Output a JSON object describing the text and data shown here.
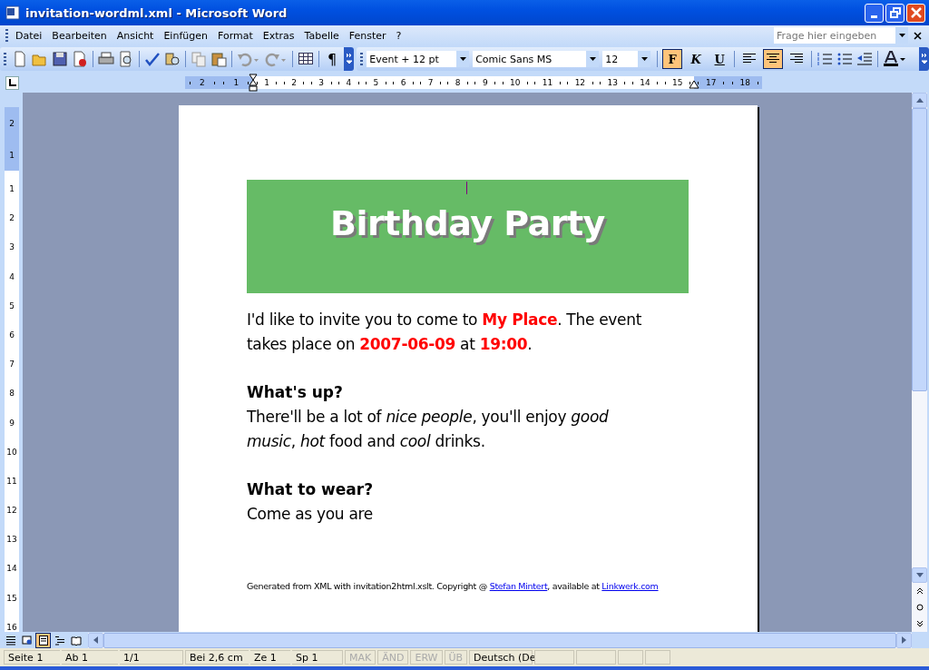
{
  "window": {
    "title": "invitation-wordml.xml - Microsoft Word"
  },
  "menu": [
    {
      "label": "Datei"
    },
    {
      "label": "Bearbeiten"
    },
    {
      "label": "Ansicht"
    },
    {
      "label": "Einfügen"
    },
    {
      "label": "Format"
    },
    {
      "label": "Extras"
    },
    {
      "label": "Tabelle"
    },
    {
      "label": "Fenster"
    },
    {
      "label": "?"
    }
  ],
  "help_box": {
    "placeholder": "Frage hier eingeben"
  },
  "toolbar": {
    "pilcrow": "¶",
    "style": "Event + 12 pt",
    "font": "Comic Sans MS",
    "size": "12",
    "format_buttons": [
      {
        "kind": "bold",
        "label": "F",
        "selected": true
      },
      {
        "kind": "italic",
        "label": "K",
        "selected": false
      },
      {
        "kind": "underline",
        "label": "U",
        "selected": false
      }
    ],
    "align_buttons": [
      {
        "kind": "left",
        "selected": false
      },
      {
        "kind": "center",
        "selected": true
      },
      {
        "kind": "right",
        "selected": false
      }
    ]
  },
  "ruler": {
    "left_labels": [
      "2",
      "1"
    ],
    "labels": [
      "1",
      "2",
      "3",
      "4",
      "5",
      "6",
      "7",
      "8",
      "9",
      "10",
      "11",
      "12",
      "13",
      "14",
      "15"
    ],
    "right_labels": [
      "17",
      "18"
    ]
  },
  "vertical_ruler": {
    "top_labels": [
      "2",
      "1"
    ],
    "labels": [
      "1",
      "2",
      "3",
      "4",
      "5",
      "6",
      "7",
      "8",
      "9",
      "10",
      "11",
      "12",
      "13",
      "14",
      "15",
      "16"
    ]
  },
  "document": {
    "banner": "Birthday Party",
    "blocks": [
      {
        "kind": "para",
        "segments": [
          {
            "kind": "plain",
            "text": "I'd like to invite you to come to "
          },
          {
            "kind": "highlight",
            "text": "My Place"
          },
          {
            "kind": "plain",
            "text": ". The event takes place on "
          },
          {
            "kind": "highlight",
            "text": "2007-06-09"
          },
          {
            "kind": "plain",
            "text": " at "
          },
          {
            "kind": "highlight",
            "text": "19:00"
          },
          {
            "kind": "plain",
            "text": "."
          }
        ]
      },
      {
        "kind": "heading",
        "text": "What's up?"
      },
      {
        "kind": "para",
        "segments": [
          {
            "kind": "plain",
            "text": "There'll be a lot of "
          },
          {
            "kind": "italic",
            "text": "nice people"
          },
          {
            "kind": "plain",
            "text": ", you'll enjoy "
          },
          {
            "kind": "italic",
            "text": "good music"
          },
          {
            "kind": "plain",
            "text": ", "
          },
          {
            "kind": "italic",
            "text": "hot"
          },
          {
            "kind": "plain",
            "text": " food and "
          },
          {
            "kind": "italic",
            "text": "cool"
          },
          {
            "kind": "plain",
            "text": " drinks."
          }
        ]
      },
      {
        "kind": "heading",
        "text": "What to wear?"
      },
      {
        "kind": "para",
        "segments": [
          {
            "kind": "plain",
            "text": "Come as you are"
          }
        ]
      }
    ],
    "footer": [
      {
        "kind": "plain",
        "text": "Generated from XML with invitation2html.xslt. Copyright @ "
      },
      {
        "kind": "link",
        "text": "Stefan Mintert"
      },
      {
        "kind": "plain",
        "text": ", available at "
      },
      {
        "kind": "link",
        "text": "Linkwerk.com"
      }
    ]
  },
  "view_buttons": [
    {
      "kind": "normal",
      "selected": false
    },
    {
      "kind": "web",
      "selected": false
    },
    {
      "kind": "print",
      "selected": true
    },
    {
      "kind": "outline",
      "selected": false
    },
    {
      "kind": "reading",
      "selected": false
    }
  ],
  "status_bar": [
    {
      "text": "Seite 1",
      "disabled": false
    },
    {
      "text": "Ab 1",
      "disabled": false
    },
    {
      "text": "1/1",
      "disabled": false
    },
    {
      "text": "Bei 2,6 cm",
      "disabled": false
    },
    {
      "text": "Ze 1",
      "disabled": false
    },
    {
      "text": "Sp 1",
      "disabled": false
    },
    {
      "text": "MAK",
      "disabled": true
    },
    {
      "text": "ÄND",
      "disabled": true
    },
    {
      "text": "ERW",
      "disabled": true
    },
    {
      "text": "ÜB",
      "disabled": true
    },
    {
      "text": "Deutsch (De",
      "disabled": false
    }
  ]
}
